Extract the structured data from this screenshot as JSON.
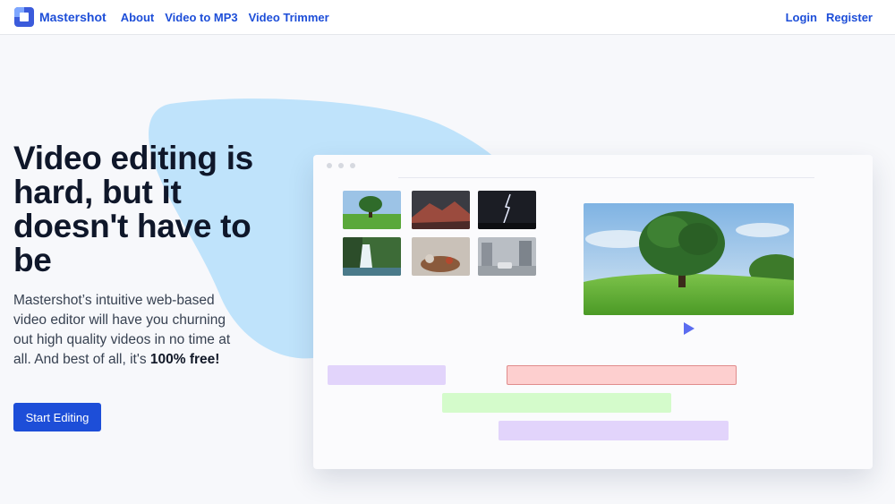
{
  "nav": {
    "brand": "Mastershot",
    "links": [
      {
        "label": "About"
      },
      {
        "label": "Video to MP3"
      },
      {
        "label": "Video Trimmer"
      }
    ],
    "login": "Login",
    "register": "Register"
  },
  "hero": {
    "headline": "Video editing is hard, but it doesn't have to be",
    "subtext_main": "Mastershot’s intuitive web-based video editor will have you churning out high quality videos in no time at all. And best of all, it's ",
    "subtext_bold": "100% free!",
    "cta": "Start Editing"
  },
  "colors": {
    "accent": "#1d4ed8",
    "blob": "#bfe3fb",
    "track_purple": "#e2d4fb",
    "track_red": "#fdcfcf",
    "track_green": "#d4fbcb",
    "play": "#5b6cf0"
  },
  "editor": {
    "thumbnails": [
      {
        "name": "tree-meadow"
      },
      {
        "name": "mountain-sunset"
      },
      {
        "name": "lightning-storm"
      },
      {
        "name": "waterfall"
      },
      {
        "name": "coffee-table"
      },
      {
        "name": "rainy-city"
      }
    ],
    "preview": "tree-meadow",
    "timeline": [
      {
        "name": "clip-purple-1",
        "color": "#e2d4fb"
      },
      {
        "name": "clip-red",
        "color": "#fdcfcf"
      },
      {
        "name": "clip-green",
        "color": "#d4fbcb"
      },
      {
        "name": "clip-purple-2",
        "color": "#e2d4fb"
      }
    ]
  }
}
